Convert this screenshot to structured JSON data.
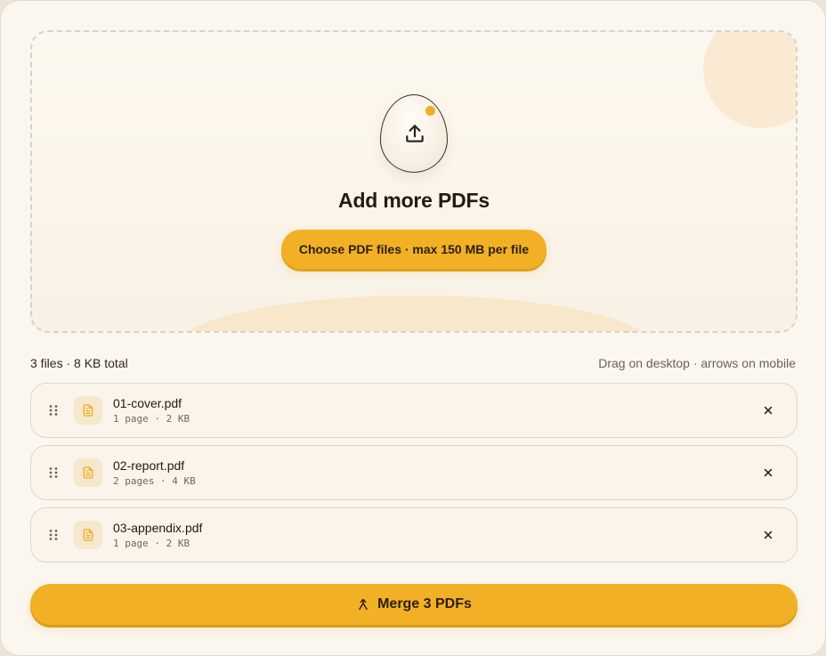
{
  "dropzone": {
    "title": "Add more PDFs",
    "choose_label": "Choose PDF files · max 150 MB per file"
  },
  "list": {
    "summary": "3 files · 8 KB total",
    "hint": "Drag on desktop · arrows on mobile"
  },
  "files": [
    {
      "name": "01-cover.pdf",
      "meta": "1 page · 2 KB"
    },
    {
      "name": "02-report.pdf",
      "meta": "2 pages · 4 KB"
    },
    {
      "name": "03-appendix.pdf",
      "meta": "1 page · 2 KB"
    }
  ],
  "merge": {
    "label": "Merge 3 PDFs"
  },
  "icons": {
    "upload": "upload-icon",
    "grip": "drag-handle-icon",
    "file": "file-icon",
    "remove": "close-icon",
    "merge": "merge-icon"
  },
  "colors": {
    "accent": "#f2b026",
    "background": "#fcf7ee",
    "text": "#231a10"
  }
}
